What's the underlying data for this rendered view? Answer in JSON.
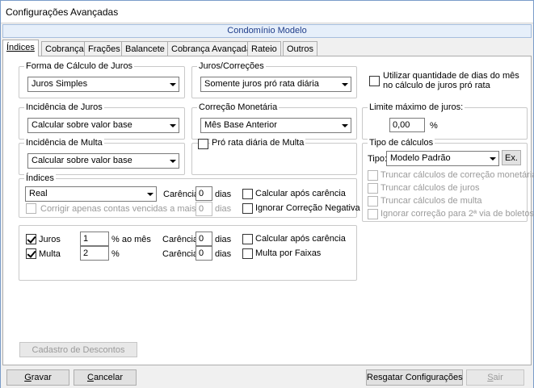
{
  "window": {
    "title": "Configurações Avançadas"
  },
  "banner": {
    "text": "Condomínio Modelo"
  },
  "tabs": [
    {
      "label": "Índices",
      "active": true
    },
    {
      "label": "Cobrança"
    },
    {
      "label": "Frações"
    },
    {
      "label": "Balancete"
    },
    {
      "label": "Cobrança Avançada"
    },
    {
      "label": "Rateio"
    },
    {
      "label": "Outros"
    }
  ],
  "forma_calculo": {
    "legend": "Forma de Cálculo de Juros",
    "value": "Juros Simples"
  },
  "juros_correcoes": {
    "legend": "Juros/Correções",
    "value": "Somente juros pró rata diária",
    "dias_mes_label_1": "Utilizar quantidade de dias do mês",
    "dias_mes_label_2": "no cálculo de juros pró rata"
  },
  "incidencia_juros": {
    "legend": "Incidência de Juros",
    "value": "Calcular sobre valor base"
  },
  "correcao_monetaria": {
    "legend": "Correção Monetária",
    "value": "Mês Base Anterior"
  },
  "limite_juros": {
    "legend": "Limite máximo de juros:",
    "value": "0,00",
    "unit": "%"
  },
  "incidencia_multa": {
    "legend": "Incidência de Multa",
    "value": "Calcular sobre valor base"
  },
  "pro_rata_multa": {
    "label": "Pró rata diária de Multa"
  },
  "indices": {
    "legend": "Índices",
    "value": "Real",
    "carencia_label": "Carência:",
    "carencia_value": "0",
    "dias_label": "dias",
    "calcular_apos_label": "Calcular após carência",
    "corrigir_label": "Corrigir apenas contas vencidas a mais de",
    "corrigir_value": "0",
    "corrigir_dias": "dias",
    "ignorar_label": "Ignorar Correção Negativa"
  },
  "tipo_calculos": {
    "legend": "Tipo de cálculos",
    "tipo_label": "Tipo:",
    "tipo_value": "Modelo Padrão",
    "ex_label": "Ex.",
    "options": [
      "Truncar cálculos de correção monetária",
      "Truncar cálculos de juros",
      "Truncar cálculos de multa",
      "Ignorar correção para 2ª via de boletos"
    ]
  },
  "juros_multa": {
    "juros_label": "Juros",
    "juros_value": "1",
    "juros_unit": "% ao mês",
    "multa_label": "Multa",
    "multa_value": "2",
    "multa_unit": "%",
    "carencia_label": "Carência:",
    "juros_carencia": "0",
    "multa_carencia": "0",
    "dias_label": "dias",
    "calcular_apos_label": "Calcular após carência",
    "multa_faixas_label": "Multa por Faixas"
  },
  "descontos": {
    "label": "Cadastro de Descontos"
  },
  "footer": {
    "gravar_u": "G",
    "gravar_rest": "ravar",
    "cancelar_u": "C",
    "cancelar_rest": "ancelar",
    "resgatar": "Resgatar Configurações",
    "sair_u": "S",
    "sair_rest": "air"
  }
}
